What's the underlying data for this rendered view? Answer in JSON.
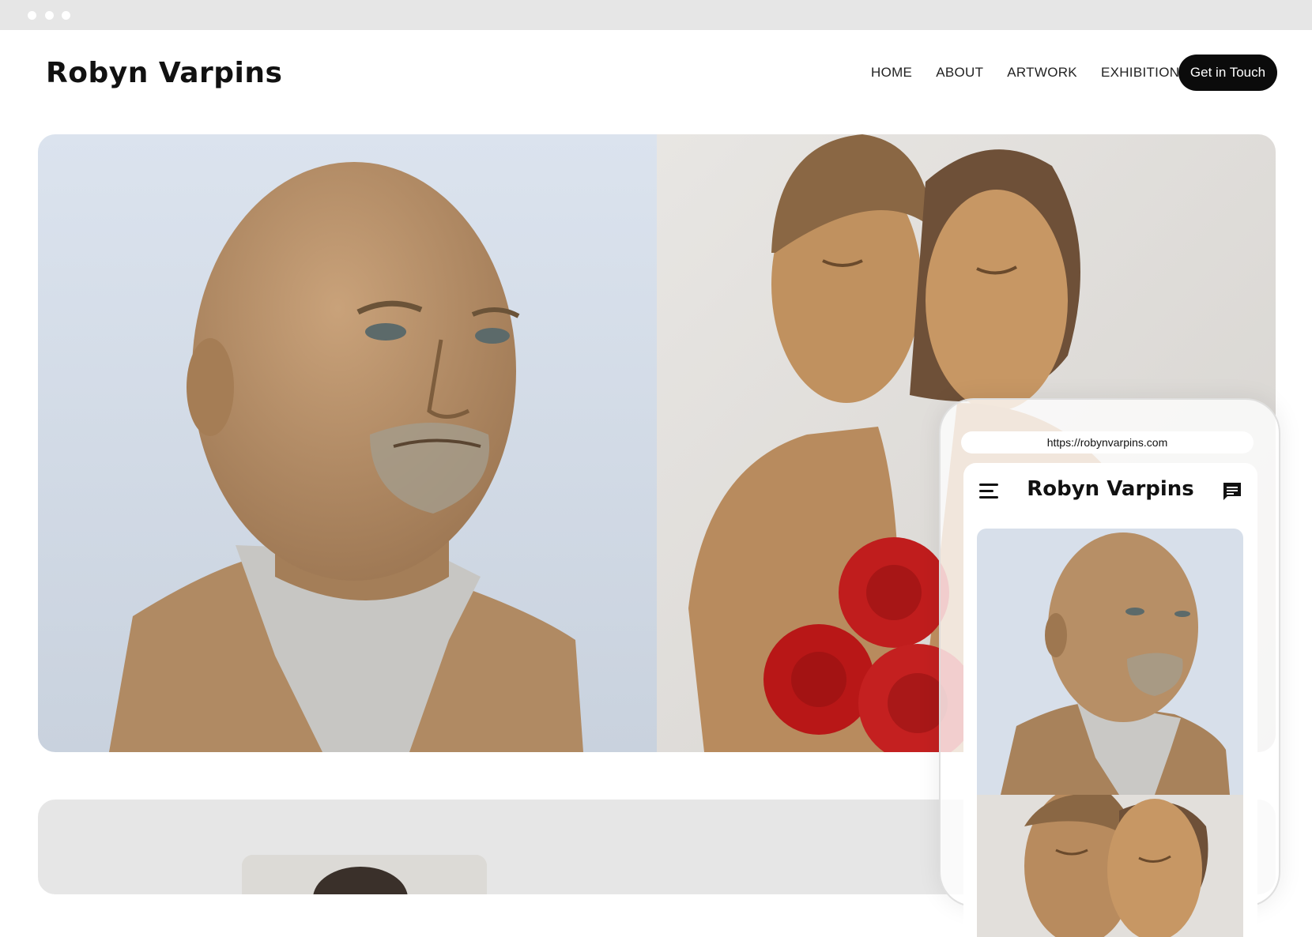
{
  "window": {
    "controls": [
      "dot",
      "dot",
      "dot"
    ]
  },
  "header": {
    "brand": "Robyn Varpins",
    "nav": [
      "HOME",
      "ABOUT",
      "ARTWORK",
      "EXHIBITIONS"
    ],
    "cta_label": "Get in Touch"
  },
  "hero": {
    "images": [
      {
        "subject": "bust-of-bald-man-sculpture"
      },
      {
        "subject": "embracing-couple-with-roses-sculpture"
      }
    ]
  },
  "phone": {
    "url": "https://robynvarpins.com",
    "brand": "Robyn Varpins",
    "icons": [
      "menu-icon",
      "chat-icon"
    ]
  },
  "colors": {
    "cta_bg": "#0b0b0b",
    "chrome_bg": "#e6e6e6",
    "section_bg": "#e6e6e6"
  }
}
